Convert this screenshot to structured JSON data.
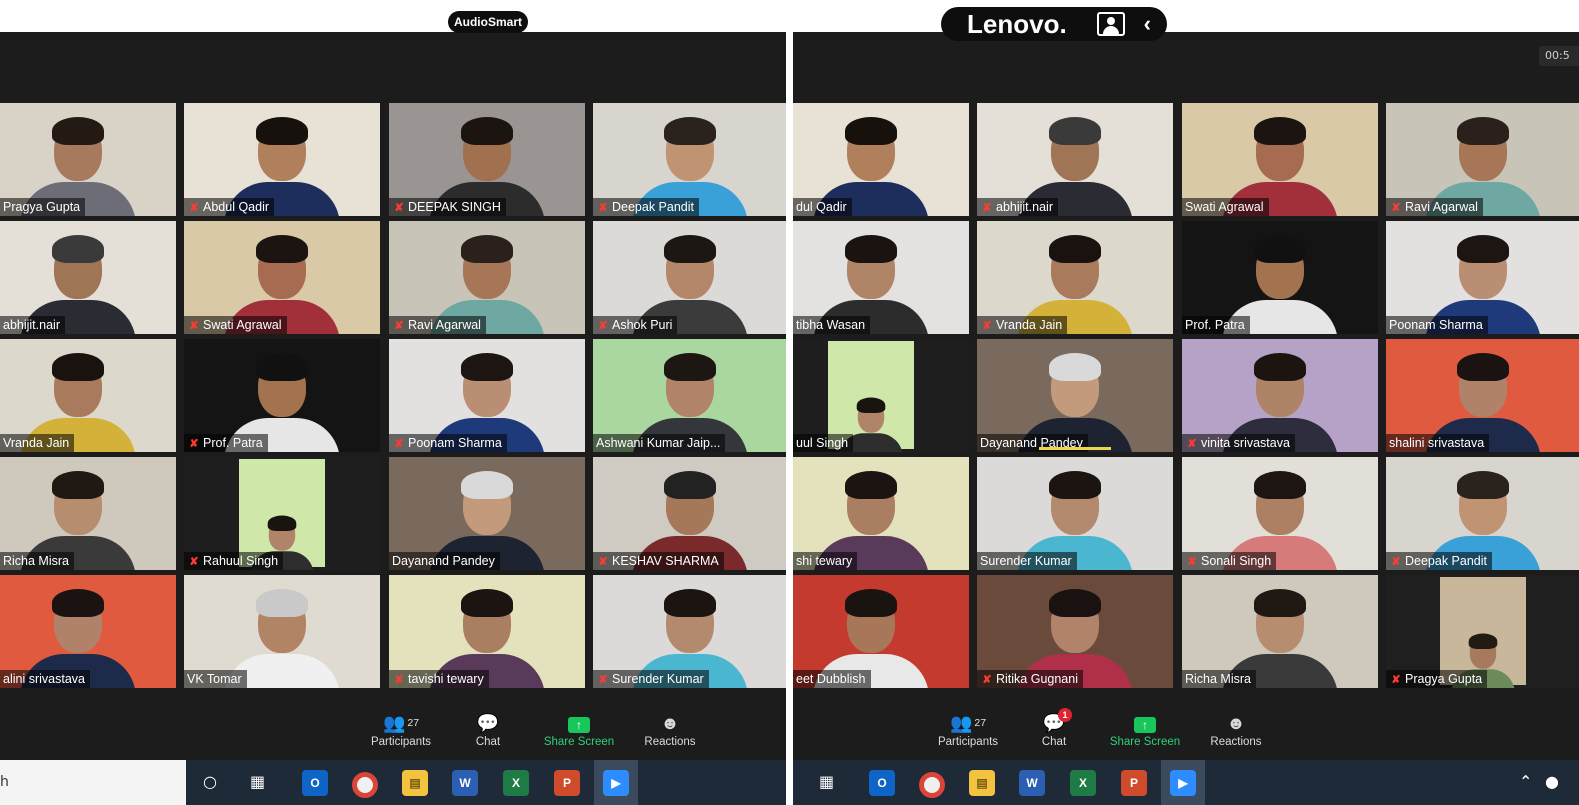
{
  "left": {
    "brand": "AudioSmart",
    "tiles": [
      {
        "name": "Pragya Gupta",
        "muted": false,
        "wall": "#d9d2c6",
        "shirt": "#6d6d78",
        "skin": "#a77a5d",
        "hair": "#231a14"
      },
      {
        "name": "Abdul Qadir",
        "muted": true,
        "wall": "#e7e1d6",
        "shirt": "#1d2d5c",
        "skin": "#b0805c",
        "hair": "#17110d"
      },
      {
        "name": "DEEPAK SINGH",
        "muted": true,
        "wall": "#9a9592",
        "shirt": "#2c2c2c",
        "skin": "#a0704f",
        "hair": "#1b1410"
      },
      {
        "name": "Deepak Pandit",
        "muted": true,
        "wall": "#d8d5cf",
        "shirt": "#3aa0d8",
        "skin": "#c09373",
        "hair": "#2a221d"
      },
      {
        "name": "abhijit.nair",
        "muted": false,
        "wall": "#e4e0d8",
        "shirt": "#2b2b33",
        "skin": "#a07556",
        "hair": "#3a3a3a"
      },
      {
        "name": "Swati Agrawal",
        "muted": true,
        "wall": "#d9c9a7",
        "shirt": "#a2303a",
        "skin": "#a66b50",
        "hair": "#1c1411"
      },
      {
        "name": "Ravi Agarwal",
        "muted": true,
        "wall": "#c9c4b8",
        "shirt": "#6fa8a3",
        "skin": "#a67657",
        "hair": "#2a211c"
      },
      {
        "name": "Ashok Puri",
        "muted": true,
        "wall": "#dcdad6",
        "shirt": "#3b3b3b",
        "skin": "#b5876a",
        "hair": "#1d1713"
      },
      {
        "name": "Vranda Jain",
        "muted": false,
        "wall": "#ddd8cc",
        "shirt": "#d4b23a",
        "skin": "#a97a5b",
        "hair": "#1a120e"
      },
      {
        "name": "Prof. Patra",
        "muted": true,
        "wall": "#141414",
        "shirt": "#e6e6e6",
        "skin": "#a3724f",
        "hair": "#111111"
      },
      {
        "name": "Poonam Sharma",
        "muted": true,
        "wall": "#e3e1df",
        "shirt": "#1f3a7a",
        "skin": "#b98e72",
        "hair": "#1c1512"
      },
      {
        "name": "Ashwani Kumar Jaip...",
        "muted": false,
        "wall": "#a9d79f",
        "shirt": "#33373b",
        "skin": "#b0836a",
        "hair": "#1c1713"
      },
      {
        "name": "Richa Misra",
        "muted": false,
        "wall": "#cfc8bd",
        "shirt": "#3a3a3a",
        "skin": "#b78d70",
        "hair": "#201813"
      },
      {
        "name": "Rahuul Singh",
        "muted": true,
        "wall": "#1e1e1e",
        "shirt": "#2d2d2d",
        "skin": "#b08468",
        "hair": "#1a1410",
        "inner": "#cfe7a8"
      },
      {
        "name": "Dayanand Pandey",
        "muted": false,
        "wall": "#7a6a5e",
        "shirt": "#1d2330",
        "skin": "#c49a7c",
        "hair": "#d9d9d9",
        "active": true
      },
      {
        "name": "KESHAV SHARMA",
        "muted": true,
        "wall": "#cfcac2",
        "shirt": "#7a2a2a",
        "skin": "#a5785a",
        "hair": "#222222"
      },
      {
        "name": "alini srivastava",
        "muted": false,
        "wall": "#e05a3f",
        "shirt": "#1e2a4a",
        "skin": "#b0826a",
        "hair": "#1a1311"
      },
      {
        "name": "VK Tomar",
        "muted": false,
        "wall": "#e0dbd1",
        "shirt": "#f0f0f0",
        "skin": "#b18466",
        "hair": "#c9c9c9"
      },
      {
        "name": "tavishi tewary",
        "muted": true,
        "wall": "#e3e2bd",
        "shirt": "#5a3a5a",
        "skin": "#a97e61",
        "hair": "#1b1411"
      },
      {
        "name": "Surender Kumar",
        "muted": true,
        "wall": "#dcdad8",
        "shirt": "#4bb6cf",
        "skin": "#b38a6d",
        "hair": "#1b1410"
      }
    ],
    "toolbar": {
      "participants": "Participants",
      "participant_count": "27",
      "chat": "Chat",
      "share": "Share Screen",
      "reactions": "Reactions",
      "chat_badge": ""
    },
    "taskbar": {
      "search": "h"
    }
  },
  "right": {
    "brand": "Lenovo.",
    "timer": "00:5",
    "tiles": [
      {
        "name": "dul Qadir",
        "muted": false,
        "wall": "#e7e1d6",
        "shirt": "#1d2d5c",
        "skin": "#b0805c",
        "hair": "#17110d"
      },
      {
        "name": "abhijit.nair",
        "muted": true,
        "wall": "#e4e0d8",
        "shirt": "#2b2b33",
        "skin": "#a07556",
        "hair": "#3a3a3a"
      },
      {
        "name": "Swati Agrawal",
        "muted": false,
        "wall": "#d9c9a7",
        "shirt": "#a2303a",
        "skin": "#a66b50",
        "hair": "#1c1411"
      },
      {
        "name": "Ravi Agarwal",
        "muted": true,
        "wall": "#c9c4b8",
        "shirt": "#6fa8a3",
        "skin": "#a67657",
        "hair": "#2a211c"
      },
      {
        "name": "tibha Wasan",
        "muted": false,
        "wall": "#e4e2e0",
        "shirt": "#2c2c2c",
        "skin": "#b08567",
        "hair": "#1a1310"
      },
      {
        "name": "Vranda Jain",
        "muted": true,
        "wall": "#ddd8cc",
        "shirt": "#d4b23a",
        "skin": "#a97a5b",
        "hair": "#1a120e"
      },
      {
        "name": "Prof. Patra",
        "muted": false,
        "wall": "#141414",
        "shirt": "#e6e6e6",
        "skin": "#a3724f",
        "hair": "#111111"
      },
      {
        "name": "Poonam Sharma",
        "muted": false,
        "wall": "#e3e1df",
        "shirt": "#1f3a7a",
        "skin": "#b98e72",
        "hair": "#1c1512",
        "active": true
      },
      {
        "name": "uul Singh",
        "muted": false,
        "wall": "#1e1e1e",
        "shirt": "#2d2d2d",
        "skin": "#b08468",
        "hair": "#1a1410",
        "inner": "#cfe7a8"
      },
      {
        "name": "Dayanand Pandey",
        "muted": false,
        "wall": "#7a6a5e",
        "shirt": "#1d2330",
        "skin": "#c49a7c",
        "hair": "#d9d9d9",
        "speaking": true
      },
      {
        "name": "vinita srivastava",
        "muted": true,
        "wall": "#b6a2c6",
        "shirt": "#2d2d3d",
        "skin": "#ad8466",
        "hair": "#1b1410"
      },
      {
        "name": "shalini srivastava",
        "muted": false,
        "wall": "#e05a3f",
        "shirt": "#1e2a4a",
        "skin": "#b0826a",
        "hair": "#1a1311"
      },
      {
        "name": "shi tewary",
        "muted": false,
        "wall": "#e3e2bd",
        "shirt": "#5a3a5a",
        "skin": "#a97e61",
        "hair": "#1b1411"
      },
      {
        "name": "Surender Kumar",
        "muted": false,
        "wall": "#dcdad8",
        "shirt": "#4bb6cf",
        "skin": "#b38a6d",
        "hair": "#1b1410"
      },
      {
        "name": "Sonali Singh",
        "muted": true,
        "wall": "#e2dfd9",
        "shirt": "#d77a7a",
        "skin": "#ad7f63",
        "hair": "#1d1512"
      },
      {
        "name": "Deepak Pandit",
        "muted": true,
        "wall": "#d8d5cf",
        "shirt": "#3aa0d8",
        "skin": "#c09373",
        "hair": "#2a221d"
      },
      {
        "name": "eet Dubblish",
        "muted": false,
        "wall": "#c53a2f",
        "shirt": "#e8e8e8",
        "skin": "#a8775a",
        "hair": "#1a1410"
      },
      {
        "name": "Ritika Gugnani",
        "muted": true,
        "wall": "#6a4a3a",
        "shirt": "#b0304a",
        "skin": "#b0836a",
        "hair": "#1a1210"
      },
      {
        "name": "Richa Misra",
        "muted": false,
        "wall": "#cfc8bd",
        "shirt": "#3a3a3a",
        "skin": "#b78d70",
        "hair": "#201813"
      },
      {
        "name": "Pragya Gupta",
        "muted": true,
        "wall": "#1f1f1f",
        "shirt": "#6d8a5a",
        "skin": "#a77a5d",
        "hair": "#231a14",
        "inner": "#c8b79a"
      }
    ],
    "toolbar": {
      "participants": "Participants",
      "participant_count": "27",
      "chat": "Chat",
      "share": "Share Screen",
      "reactions": "Reactions",
      "chat_badge": "1"
    }
  },
  "colors": {
    "meeting_bg": "#1c1c1c",
    "taskbar_bg": "#1f2a38",
    "share_green": "#2ed07a",
    "active_border": "#cfe84a",
    "mute_red": "#ff3b30"
  }
}
